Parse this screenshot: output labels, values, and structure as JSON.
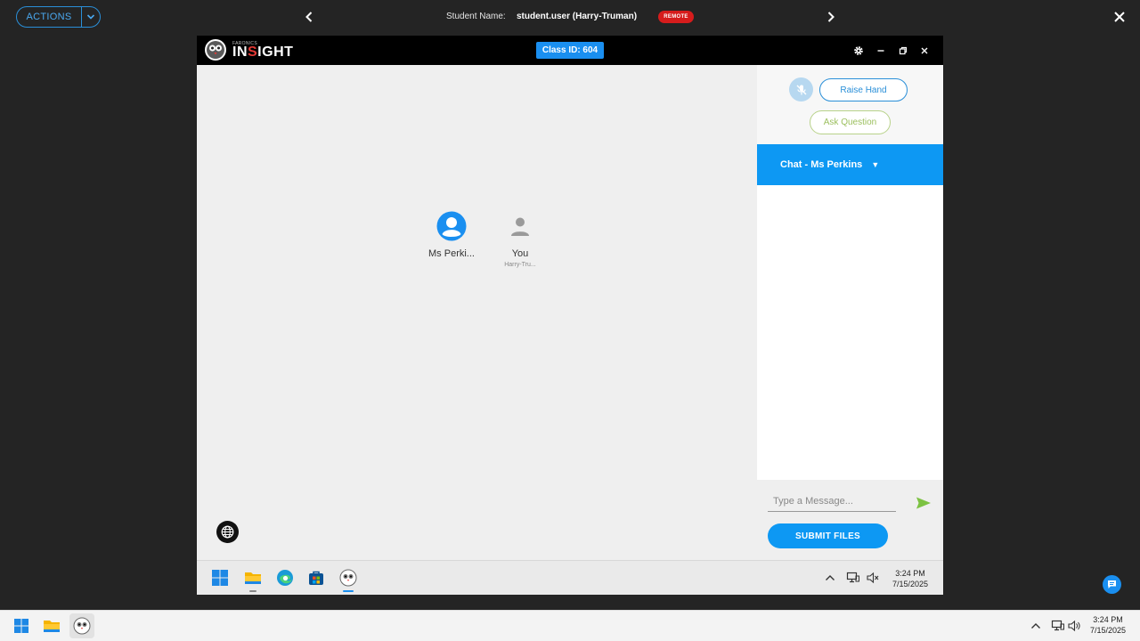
{
  "topbar": {
    "actions_label": "ACTIONS",
    "student_label": "Student Name:",
    "student_value": "student.user (Harry-Truman)",
    "remote_badge": "REMOTE"
  },
  "app": {
    "logo_small": "FARONICS",
    "logo_prefix": "IN",
    "logo_accent": "S",
    "logo_suffix": "IGHT",
    "class_id": "Class ID: 604"
  },
  "participants": [
    {
      "name": "Ms Perki...",
      "sub": ""
    },
    {
      "name": "You",
      "sub": "Harry-Tru..."
    }
  ],
  "side": {
    "raise_hand": "Raise Hand",
    "ask_question": "Ask Question",
    "chat_title": "Chat - Ms Perkins",
    "message_placeholder": "Type a Message...",
    "submit_files": "SUBMIT FILES"
  },
  "inner_taskbar": {
    "time": "3:24 PM",
    "date": "7/15/2025"
  },
  "host_taskbar": {
    "time": "3:24 PM",
    "date": "7/15/2025"
  },
  "colors": {
    "accent": "#0d98f3",
    "remote": "#d61c1c",
    "ask_green": "#9bbf5d"
  }
}
